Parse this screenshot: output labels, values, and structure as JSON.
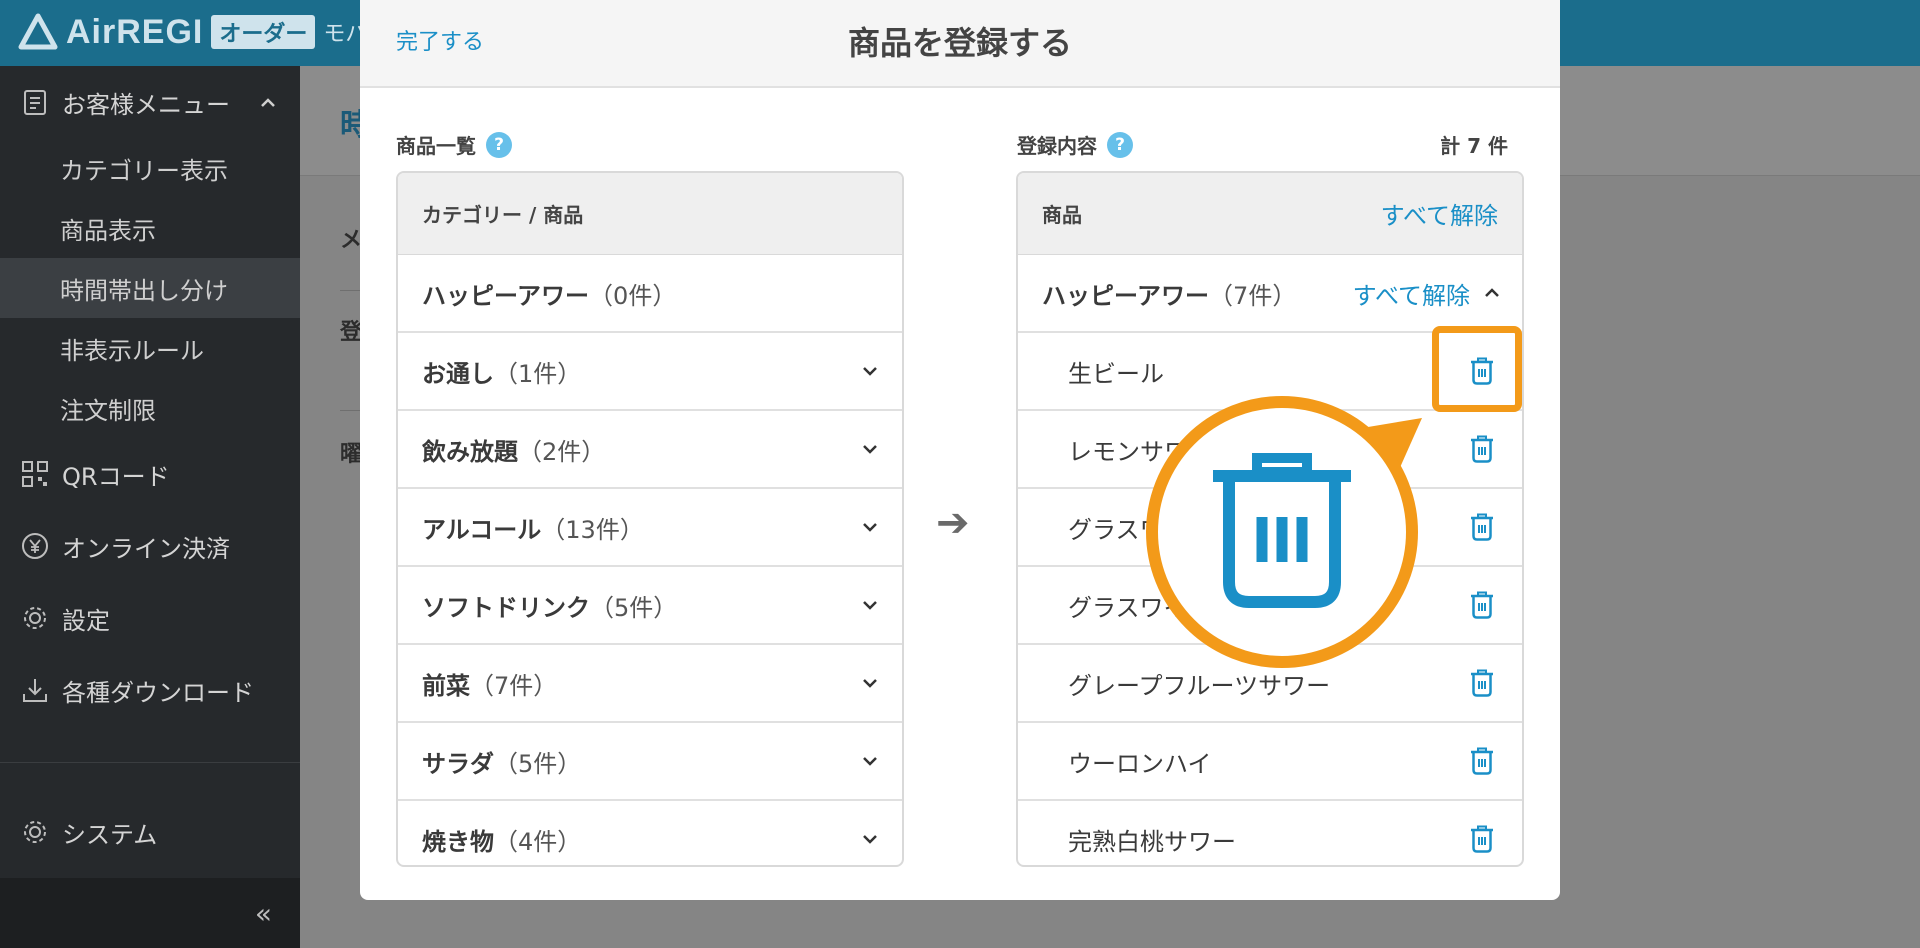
{
  "header": {
    "brand": "AirREGI",
    "badge": "オーダー",
    "sub": "モバ"
  },
  "sidebar": {
    "customer_menu": "お客様メニュー",
    "sub_items": [
      "カテゴリー表示",
      "商品表示",
      "時間帯出し分け",
      "非表示ルール",
      "注文制限"
    ],
    "active_index": 2,
    "qr": "QRコード",
    "online_payment": "オンライン決済",
    "settings": "設定",
    "downloads": "各種ダウンロード",
    "system": "システム",
    "collapse": "«"
  },
  "background": {
    "title": "時",
    "label1": "メ",
    "label2": "登",
    "label3": "曜"
  },
  "modal": {
    "done": "完了する",
    "title": "商品を登録する",
    "arrow": "➔",
    "left": {
      "label": "商品一覧",
      "help": "?",
      "header": "カテゴリー / 商品",
      "rows": [
        {
          "name": "ハッピーアワー",
          "count": "（0件）",
          "chevron": false
        },
        {
          "name": "お通し",
          "count": "（1件）",
          "chevron": true
        },
        {
          "name": "飲み放題",
          "count": "（2件）",
          "chevron": true
        },
        {
          "name": "アルコール",
          "count": "（13件）",
          "chevron": true
        },
        {
          "name": "ソフトドリンク",
          "count": "（5件）",
          "chevron": true
        },
        {
          "name": "前菜",
          "count": "（7件）",
          "chevron": true
        },
        {
          "name": "サラダ",
          "count": "（5件）",
          "chevron": true
        },
        {
          "name": "焼き物",
          "count": "（4件）",
          "chevron": true
        }
      ]
    },
    "right": {
      "label": "登録内容",
      "help": "?",
      "total": "計 7 件",
      "header": "商品",
      "clear_all": "すべて解除",
      "group": {
        "name": "ハッピーアワー",
        "count": "（7件）",
        "clear": "すべて解除"
      },
      "items": [
        "生ビール",
        "レモンサワー",
        "グラスワイン",
        "グラスワイン",
        "グレープフルーツサワー",
        "ウーロンハイ",
        "完熟白桃サワー"
      ]
    }
  },
  "colors": {
    "accent": "#1a8fc7",
    "highlight": "#f39a19",
    "header": "#1b6d8c",
    "sidebar": "#26292c"
  }
}
